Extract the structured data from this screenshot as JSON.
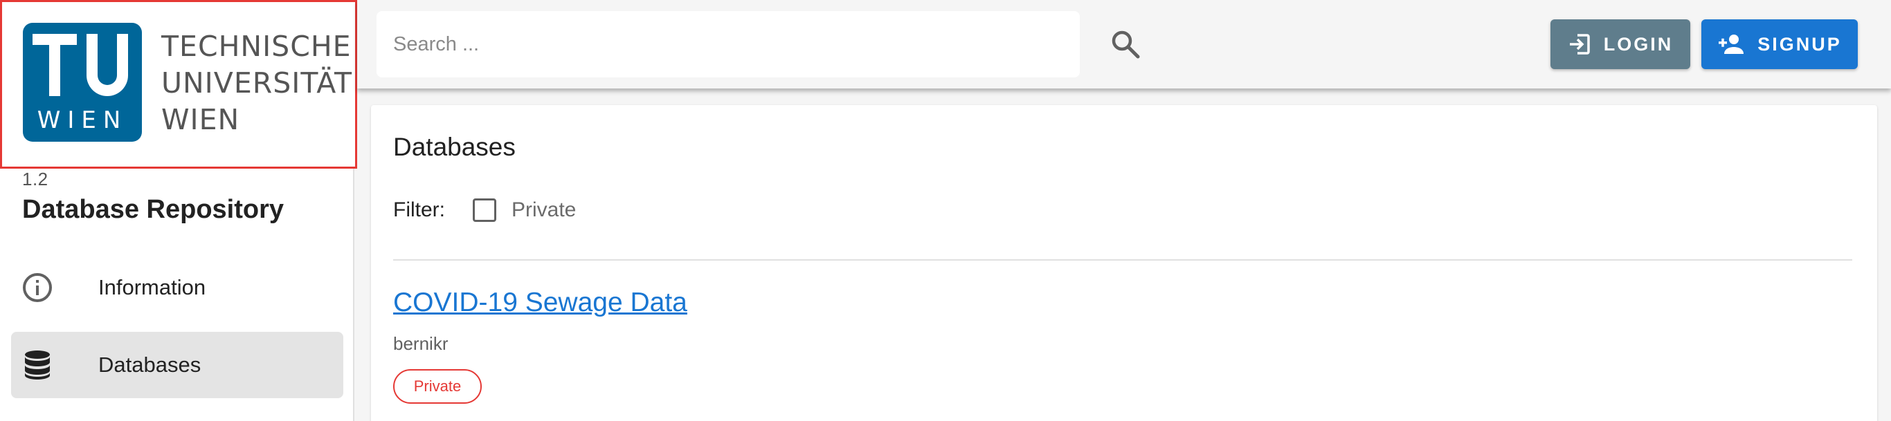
{
  "sidebar": {
    "logo": {
      "mark_top": "TU",
      "mark_bottom": "WIEN",
      "lines": [
        "TECHNISCHE",
        "UNIVERSITÄT",
        "WIEN"
      ],
      "brand_color": "#006699"
    },
    "version": "1.2",
    "app_name": "Database Repository",
    "items": [
      {
        "label": "Information",
        "icon": "info-icon",
        "active": false
      },
      {
        "label": "Databases",
        "icon": "database-icon",
        "active": true
      }
    ]
  },
  "header": {
    "search": {
      "placeholder": "Search ...",
      "value": ""
    },
    "login_label": "LOGIN",
    "signup_label": "SIGNUP",
    "login_color": "#5f7d8c",
    "signup_color": "#1976d2"
  },
  "main": {
    "title": "Databases",
    "filter": {
      "label": "Filter:",
      "option": "Private",
      "checked": false
    },
    "databases": [
      {
        "title": "COVID-19 Sewage Data",
        "owner": "bernikr",
        "badge": "Private"
      }
    ]
  },
  "colors": {
    "accent": "#1976d2",
    "private_badge": "#e53935",
    "highlight_outline": "#e53935"
  }
}
